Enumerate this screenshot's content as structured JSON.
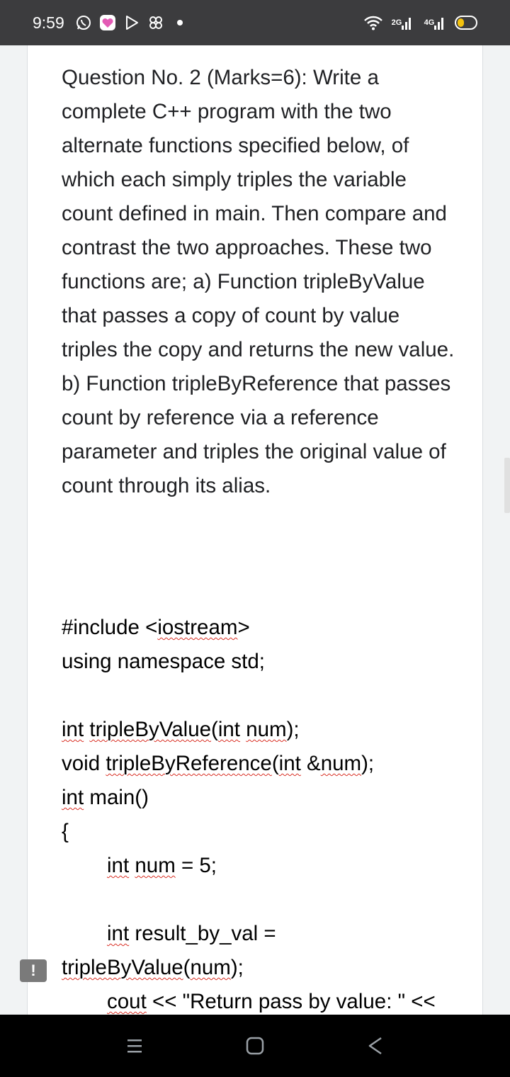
{
  "status_bar": {
    "time": "9:59",
    "left_icons": [
      "whatsapp-icon",
      "heart-app-icon",
      "play-store-icon",
      "share-app-icon",
      "notification-dot-icon"
    ],
    "network_1": "2G",
    "network_2": "4G"
  },
  "question": {
    "text": "Question No. 2 (Marks=6): Write a complete C++ program with the two alternate functions specified below, of which each simply triples the variable count defined in main. Then compare and contrast the two approaches. These two functions are; a) Function tripleByValue that passes a copy of count by value triples the copy and returns the new value. b) Function tripleByReference that passes count by reference via a reference parameter and triples the original value of count through its alias."
  },
  "code": {
    "l1_a": "#include <",
    "l1_b": "iostream",
    "l1_c": ">",
    "l2": "using namespace std;",
    "l3_a": "int",
    "l3_b": " ",
    "l3_c": "tripleByValue",
    "l3_d": "(",
    "l3_e": "int",
    "l3_f": " ",
    "l3_g": "num",
    "l3_h": ");",
    "l4_a": "void ",
    "l4_b": "tripleByReference",
    "l4_c": "(",
    "l4_d": "int",
    "l4_e": " &",
    "l4_f": "num",
    "l4_g": ");",
    "l5_a": "int",
    "l5_b": " main()",
    "l6": "{",
    "l7_a": "int",
    "l7_b": " ",
    "l7_c": "num",
    "l7_d": " = 5;",
    "l8_a": "int",
    "l8_b": " result_by_val =",
    "l9_a": "tripleByValue",
    "l9_b": "(",
    "l9_c": "num",
    "l9_d": ");",
    "l10_a": "cout",
    "l10_b": " << \"Return pass by value: \" <<"
  },
  "comment_badge": "!"
}
